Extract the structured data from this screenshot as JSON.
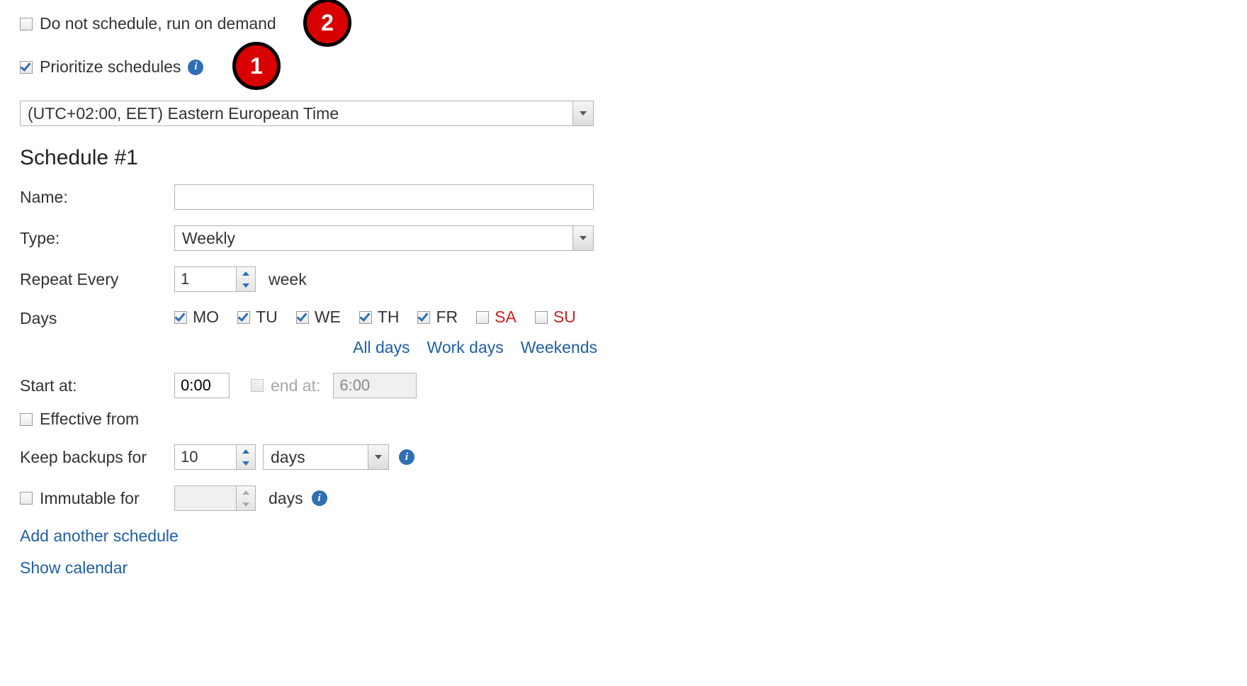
{
  "options": {
    "do_not_schedule_label": "Do not schedule, run on demand",
    "do_not_schedule_checked": false,
    "prioritize_label": "Prioritize schedules",
    "prioritize_checked": true
  },
  "callouts": {
    "one": "1",
    "two": "2"
  },
  "timezone": "(UTC+02:00, EET) Eastern European Time",
  "schedule": {
    "heading": "Schedule #1",
    "name_label": "Name:",
    "name_value": "",
    "type_label": "Type:",
    "type_value": "Weekly",
    "repeat_label": "Repeat Every",
    "repeat_value": "1",
    "repeat_unit": "week",
    "days_label": "Days",
    "days": [
      {
        "code": "MO",
        "checked": true,
        "weekend": false
      },
      {
        "code": "TU",
        "checked": true,
        "weekend": false
      },
      {
        "code": "WE",
        "checked": true,
        "weekend": false
      },
      {
        "code": "TH",
        "checked": true,
        "weekend": false
      },
      {
        "code": "FR",
        "checked": true,
        "weekend": false
      },
      {
        "code": "SA",
        "checked": false,
        "weekend": true
      },
      {
        "code": "SU",
        "checked": false,
        "weekend": true
      }
    ],
    "quick": {
      "all": "All days",
      "work": "Work days",
      "weekends": "Weekends"
    },
    "start_label": "Start at:",
    "start_value": "0:00",
    "end_checked": false,
    "end_label": "end at:",
    "end_value": "6:00",
    "effective_from_label": "Effective from",
    "effective_from_checked": false,
    "keep_label": "Keep backups for",
    "keep_value": "10",
    "keep_unit": "days",
    "immutable_label": "Immutable for",
    "immutable_checked": false,
    "immutable_value": "",
    "immutable_unit": "days"
  },
  "links": {
    "add_schedule": "Add another schedule",
    "show_calendar": "Show calendar"
  }
}
